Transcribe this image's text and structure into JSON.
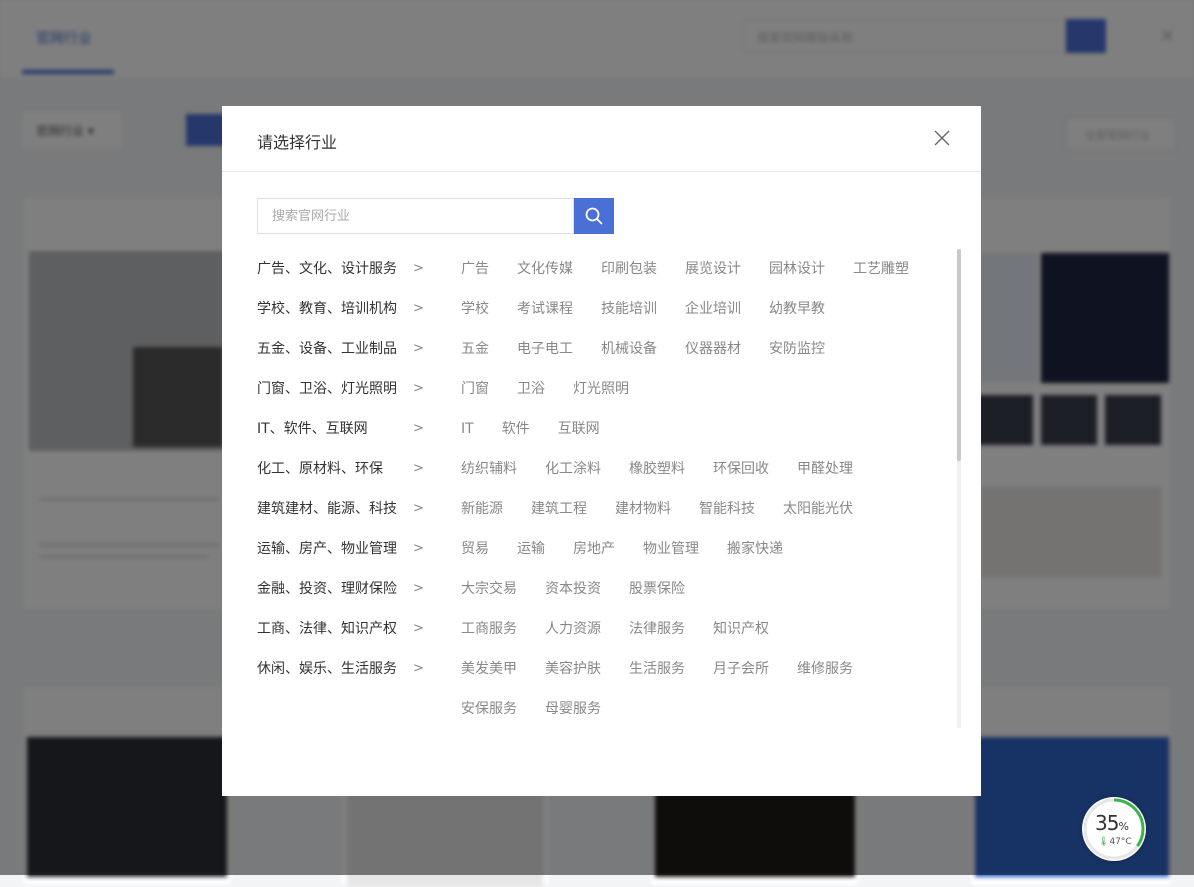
{
  "modal": {
    "title": "请选择行业",
    "search_placeholder": "搜索官网行业",
    "categories": [
      {
        "label": "广告、文化、设计服务",
        "subs": [
          "广告",
          "文化传媒",
          "印刷包装",
          "展览设计",
          "园林设计",
          "工艺雕塑"
        ]
      },
      {
        "label": "学校、教育、培训机构",
        "subs": [
          "学校",
          "考试课程",
          "技能培训",
          "企业培训",
          "幼教早教"
        ]
      },
      {
        "label": "五金、设备、工业制品",
        "subs": [
          "五金",
          "电子电工",
          "机械设备",
          "仪器器材",
          "安防监控"
        ]
      },
      {
        "label": "门窗、卫浴、灯光照明",
        "subs": [
          "门窗",
          "卫浴",
          "灯光照明"
        ]
      },
      {
        "label": "IT、软件、互联网",
        "subs": [
          "IT",
          "软件",
          "互联网"
        ]
      },
      {
        "label": "化工、原材料、环保",
        "subs": [
          "纺织辅料",
          "化工涂料",
          "橡胶塑料",
          "环保回收",
          "甲醛处理"
        ]
      },
      {
        "label": "建筑建材、能源、科技",
        "subs": [
          "新能源",
          "建筑工程",
          "建材物料",
          "智能科技",
          "太阳能光伏"
        ]
      },
      {
        "label": "运输、房产、物业管理",
        "subs": [
          "贸易",
          "运输",
          "房地产",
          "物业管理",
          "搬家快递"
        ]
      },
      {
        "label": "金融、投资、理财保险",
        "subs": [
          "大宗交易",
          "资本投资",
          "股票保险"
        ]
      },
      {
        "label": "工商、法律、知识产权",
        "subs": [
          "工商服务",
          "人力资源",
          "法律服务",
          "知识产权"
        ]
      },
      {
        "label": "休闲、娱乐、生活服务",
        "subs": [
          "美发美甲",
          "美容护肤",
          "生活服务",
          "月子会所",
          "维修服务",
          "安保服务",
          "母婴服务"
        ]
      }
    ]
  },
  "background": {
    "tab_label": "官网行业",
    "search_placeholder": "搜索官网模板名称",
    "filter_label": "官网行业 ▾",
    "right_button": "全部官网行业"
  },
  "widget": {
    "percent": "35",
    "percent_unit": "%",
    "temperature": "47°C"
  },
  "colors": {
    "accent": "#4a6fd6",
    "widget_ring": "#3bb34a"
  }
}
